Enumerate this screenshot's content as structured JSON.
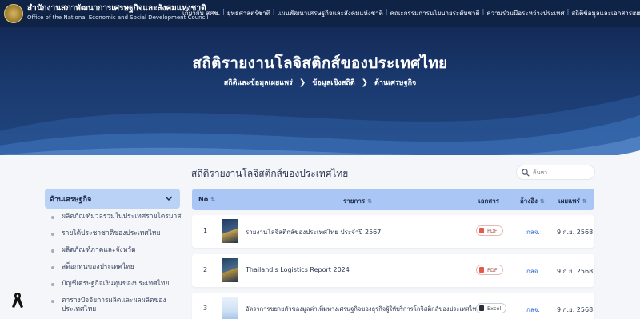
{
  "header": {
    "org_th": "สำนักงานสภาพัฒนาการเศรษฐกิจและสังคมแห่งชาติ",
    "org_en": "Office of the National Economic and Social Development Council",
    "nav": [
      "เกี่ยวกับ สศช.",
      "ยุทธศาสตร์ชาติ",
      "แผนพัฒนาเศรษฐกิจและสังคมแห่งชาติ",
      "คณะกรรมการนโยบายระดับชาติ",
      "ความร่วมมือระหว่างประเทศ",
      "สถิติข้อมูลและเอกสารเผยแพร่"
    ]
  },
  "hero": {
    "title": "สถิติรายงานโลจิสติกส์ของประเทศไทย",
    "breadcrumb": [
      "สถิติและข้อมูลเผยแพร่",
      "ข้อมูลเชิงสถิติ",
      "ด้านเศรษฐกิจ"
    ]
  },
  "content": {
    "section_title": "สถิติรายงานโลจิสติกส์ของประเทศไทย",
    "search_placeholder": "ค้นหา"
  },
  "sidebar": {
    "heading": "ด้านเศรษฐกิจ",
    "items": [
      "ผลิตภัณฑ์มวลรวมในประเทศรายไตรมาส",
      "รายได้ประชาชาติของประเทศไทย",
      "ผลิตภัณฑ์ภาคและจังหวัด",
      "สต็อกทุนของประเทศไทย",
      "บัญชีเศรษฐกิจเงินทุนของประเทศไทย",
      "ตารางปัจจัยการผลิตและผลผลิตของประเทศไทย"
    ]
  },
  "table": {
    "headers": {
      "no": "No",
      "name": "รายการ",
      "doc": "เอกสาร",
      "ref": "อ้างอิง",
      "date": "เผยแพร่"
    },
    "rows": [
      {
        "no": "1",
        "name": "รายงานโลจิสติกส์ของประเทศไทย ประจำปี 2567",
        "doc": "PDF",
        "ref": "กลจ.",
        "date": "9 ก.ย. 2568"
      },
      {
        "no": "2",
        "name": "Thailand's Logistics Report 2024",
        "doc": "PDF",
        "ref": "กลจ.",
        "date": "9 ก.ย. 2568"
      },
      {
        "no": "3",
        "name": "อัตราการขยายตัวของมูลค่าเพิ่มทางเศรษฐกิจของธุรกิจผู้ให้บริการโลจิสติกส์ของประเทศไทย",
        "doc": "Excel",
        "ref": "กลจ.",
        "date": "9 ก.ย. 2568"
      }
    ]
  }
}
